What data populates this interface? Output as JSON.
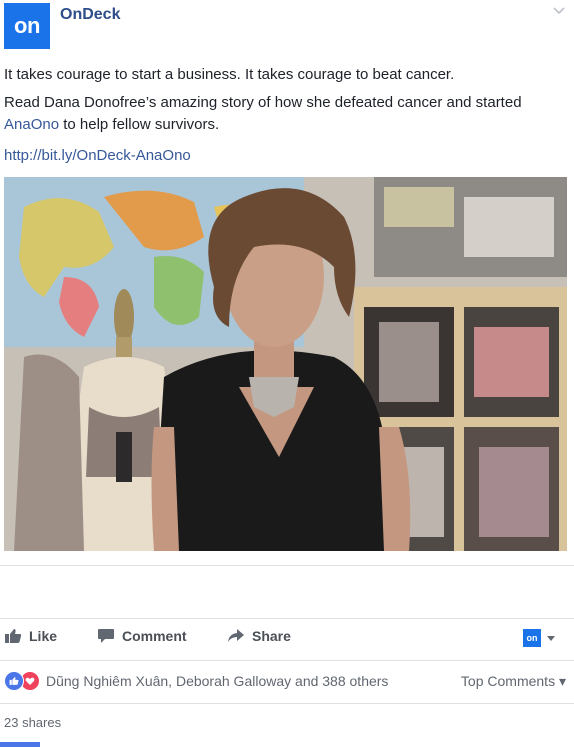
{
  "header": {
    "logo_text": "on",
    "page_name": "OnDeck",
    "brand_color": "#1a73e8"
  },
  "post": {
    "line1": "It takes courage to start a business. It takes courage to beat cancer.",
    "line2_before": "Read Dana Donofree’s amazing story of how she defeated cancer and started ",
    "line2_link": "AnaOno",
    "line2_after": " to help fellow survivors.",
    "url": "http://bit.ly/OnDeck-AnaOno"
  },
  "actions": {
    "like_label": "Like",
    "comment_label": "Comment",
    "share_label": "Share",
    "selector_logo_text": "on"
  },
  "reactions": {
    "names": "Dũng Nghiêm Xuân, Deborah Galloway and 388 others",
    "top_comments": "Top Comments",
    "shares": "23 shares"
  },
  "icons": [
    "chevron-down-icon",
    "like-icon",
    "comment-icon",
    "share-icon",
    "love-icon"
  ]
}
